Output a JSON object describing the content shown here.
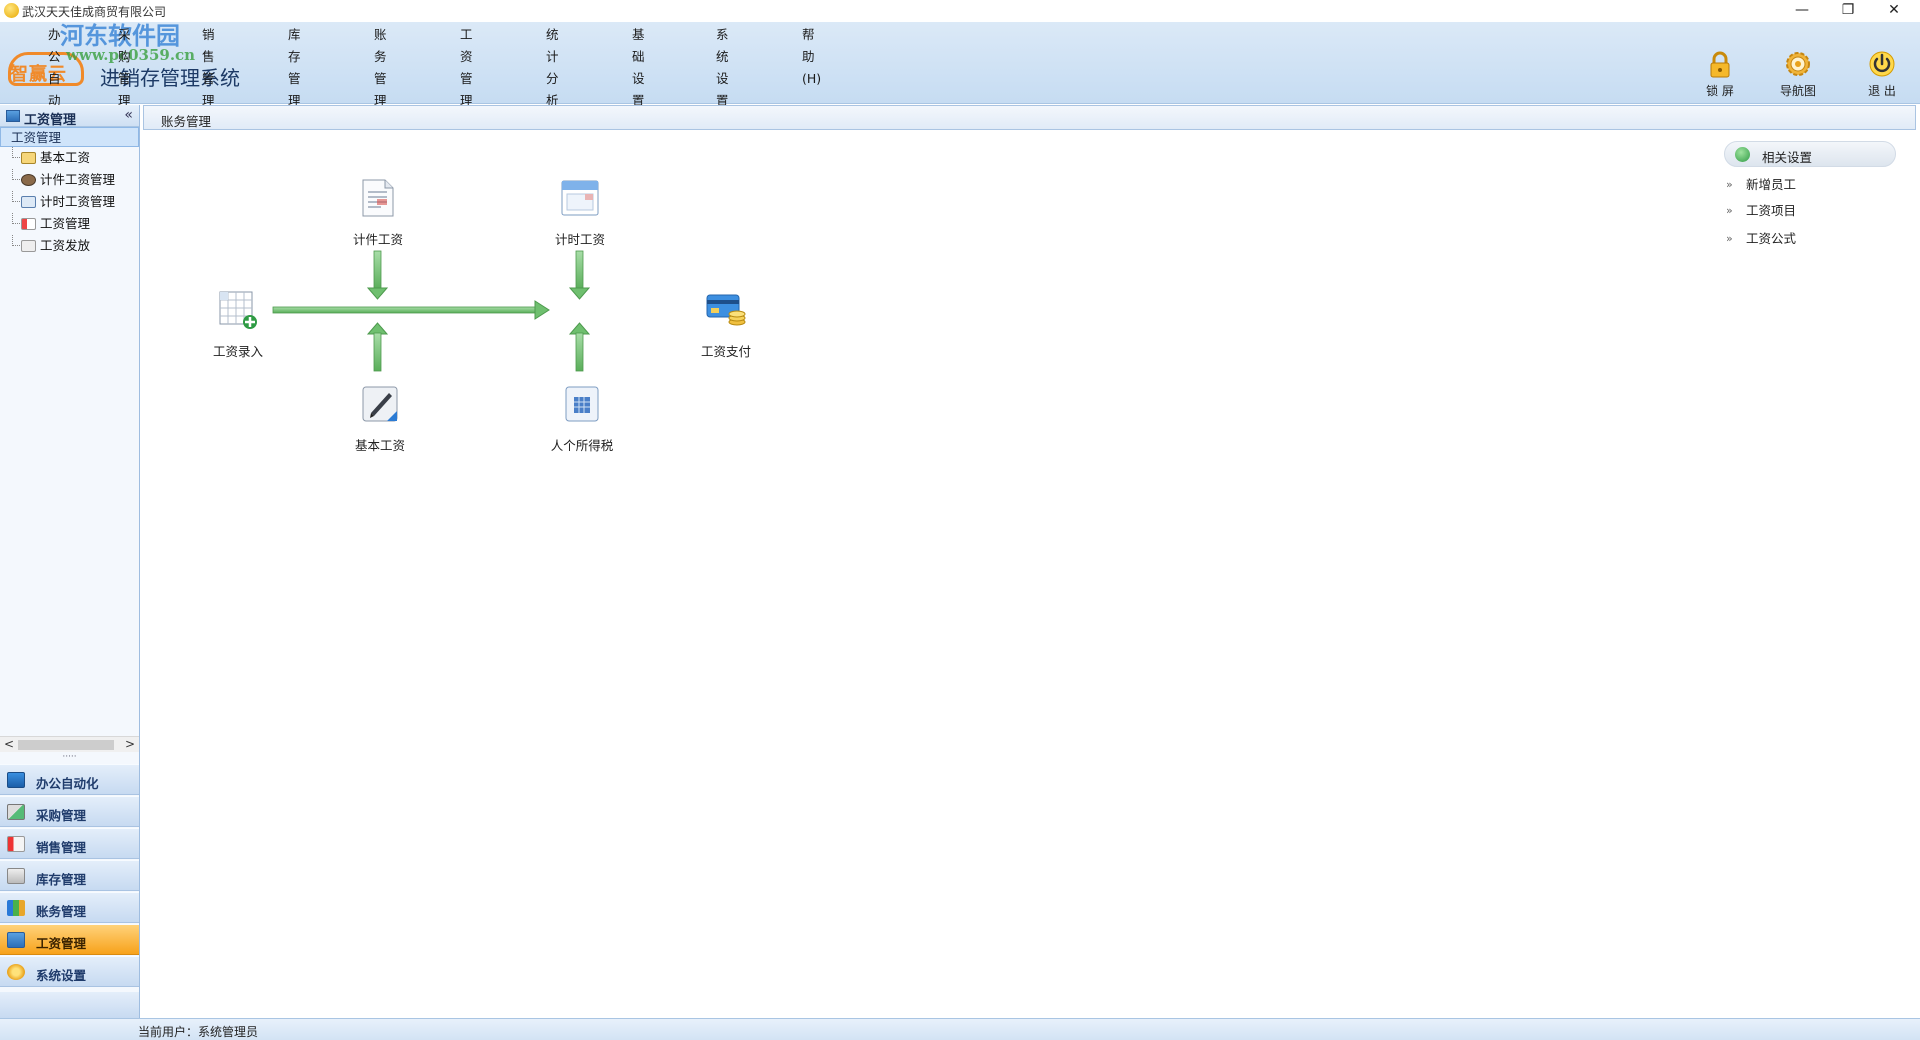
{
  "window": {
    "title": "武汉天天佳成商贸有限公司",
    "minimize": "—",
    "restore": "❐",
    "close": "✕"
  },
  "menu": [
    "办公自动化(O)",
    "采购管理(C)",
    "销售管理(X)",
    "库存管理(K)",
    "账务管理(Z)",
    "工资管理(T)",
    "统计分析(R)",
    "基础设置(J)",
    "系统设置(U)",
    "帮助(H)"
  ],
  "logo": {
    "brand": "智赢云",
    "watermark_title": "河东软件园",
    "watermark_url": "www.pc0359.cn"
  },
  "system_title": "进销存管理系统",
  "toolbar": {
    "lock": "锁 屏",
    "navmap": "导航图",
    "exit": "退 出"
  },
  "sidebar": {
    "header": "工资管理",
    "collapse": "«",
    "tree_root": "工资管理",
    "tree_items": [
      "基本工资",
      "计件工资管理",
      "计时工资管理",
      "工资管理",
      "工资发放"
    ],
    "scroll_left": "<",
    "scroll_right": ">",
    "grip": "·····",
    "nav": [
      "办公自动化",
      "采购管理",
      "销售管理",
      "库存管理",
      "账务管理",
      "工资管理",
      "系统设置"
    ]
  },
  "breadcrumb": "账务管理",
  "flow": {
    "payroll_entry": "工资录入",
    "piece_wage": "计件工资",
    "time_wage": "计时工资",
    "basic_wage": "基本工资",
    "income_tax": "人个所得税",
    "wage_payment": "工资支付"
  },
  "related": {
    "header": "相关设置",
    "links": [
      "新增员工",
      "工资项目",
      "工资公式"
    ]
  },
  "status": {
    "current_user": "当前用户：系统管理员"
  },
  "colors": {
    "accent_active": "#f7a21b",
    "header_bg": "#c6dcf2",
    "flow_arrow": "#6fbf6f"
  }
}
